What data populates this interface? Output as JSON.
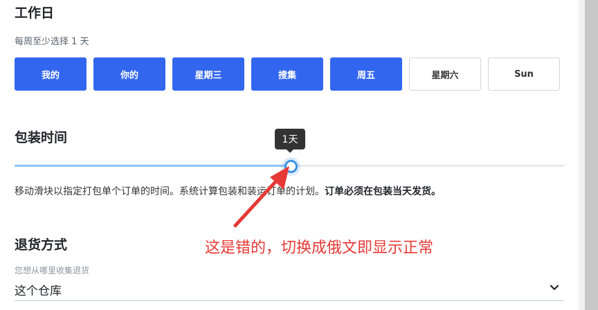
{
  "workdays": {
    "title": "工作日",
    "subtitle": "每周至少选择 1 天",
    "days": [
      {
        "label": "我的",
        "selected": true
      },
      {
        "label": "你的",
        "selected": true
      },
      {
        "label": "星期三",
        "selected": true
      },
      {
        "label": "搜集",
        "selected": true
      },
      {
        "label": "周五",
        "selected": true
      },
      {
        "label": "星期六",
        "selected": false
      },
      {
        "label": "Sun",
        "selected": false
      }
    ]
  },
  "packing": {
    "title": "包装时间",
    "slider_tooltip": "1天",
    "slider_fraction": 0.5,
    "description": "移动滑块以指定打包单个订单的时间。系统计算包装和装运订单的计划。",
    "description_bold": "订单必须在包装当天发货。"
  },
  "annotation": {
    "text": "这是错的，切换成俄文即显示正常",
    "color": "#e53935"
  },
  "returns": {
    "title": "退货方式",
    "field_label": "您想从哪里收集退货",
    "selected_value": "这个仓库"
  },
  "colors": {
    "accent": "#3366ee",
    "slider": "#3d8fe0"
  }
}
